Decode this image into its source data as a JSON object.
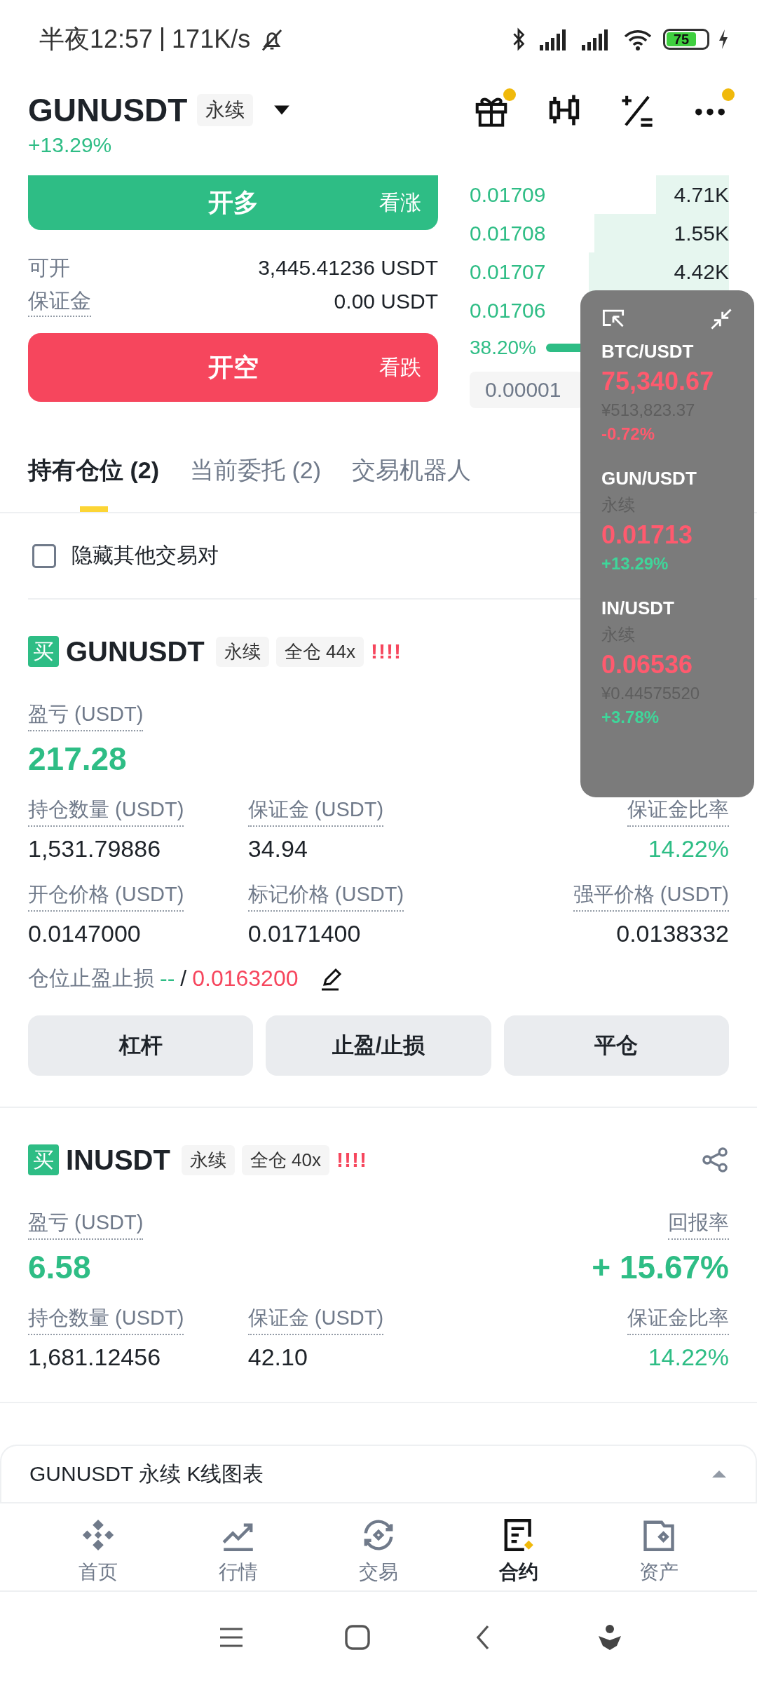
{
  "status_bar": {
    "time": "半夜12:57",
    "speed": "171K/s",
    "battery": "75"
  },
  "header": {
    "symbol": "GUNUSDT",
    "tag": "永续",
    "change": "+13.29%",
    "gift_badge": true,
    "more_badge": true
  },
  "order_buttons": [
    {
      "kind": "long",
      "label": "开多",
      "hint": "看涨"
    },
    {
      "kind": "short",
      "label": "开空",
      "hint": "看跌"
    }
  ],
  "account": [
    {
      "label": "可开",
      "value": "3,445.41236 USDT",
      "underlined": false
    },
    {
      "label": "保证金",
      "value": "0.00 USDT",
      "underlined": true
    }
  ],
  "order_book": {
    "rows": [
      {
        "price": "0.01709",
        "amount": "4.71K"
      },
      {
        "price": "0.01708",
        "amount": "1.55K"
      },
      {
        "price": "0.01707",
        "amount": "4.42K"
      },
      {
        "price": "0.01706"
      }
    ],
    "buy_ratio": "38.20%",
    "tick_size": "0.00001"
  },
  "tabs": [
    {
      "label": "持有仓位 (2)",
      "selected": true
    },
    {
      "label": "当前委托 (2)",
      "selected": false
    },
    {
      "label": "交易机器人",
      "selected": false
    }
  ],
  "hide_other_pairs": {
    "label": "隐藏其他交易对",
    "checked": false
  },
  "positions": [
    {
      "side": "买",
      "symbol": "GUNUSDT",
      "tags": [
        "永续",
        "全仓 44x"
      ],
      "risk": "!!!!",
      "pnl_label": "盈亏 (USDT)",
      "pnl": "217.28",
      "field_rows": [
        [
          {
            "label": "持仓数量 (USDT)",
            "value": "1,531.79886",
            "positive": false
          },
          {
            "label": "保证金 (USDT)",
            "value": "34.94",
            "positive": false
          },
          {
            "label": "保证金比率",
            "value": "14.22%",
            "positive": true
          }
        ],
        [
          {
            "label": "开仓价格 (USDT)",
            "value": "0.0147000",
            "positive": false
          },
          {
            "label": "标记价格 (USDT)",
            "value": "0.0171400",
            "positive": false
          },
          {
            "label": "强平价格 (USDT)",
            "value": "0.0138332",
            "positive": false
          }
        ]
      ],
      "tpsl": {
        "label": "仓位止盈止损",
        "tp": "--",
        "sep": "/",
        "sl": "0.0163200"
      },
      "actions": [
        "杠杆",
        "止盈/止损",
        "平仓"
      ]
    },
    {
      "side": "买",
      "symbol": "INUSDT",
      "tags": [
        "永续",
        "全仓 40x"
      ],
      "risk": "!!!!",
      "share": true,
      "pnl_label": "盈亏 (USDT)",
      "pnl": "6.58",
      "roi_label": "回报率",
      "roi": "+ 15.67%",
      "field_rows": [
        [
          {
            "label": "持仓数量 (USDT)",
            "value": "1,681.12456",
            "positive": false
          },
          {
            "label": "保证金 (USDT)",
            "value": "42.10",
            "positive": false
          },
          {
            "label": "保证金比率",
            "value": "14.22%",
            "positive": true
          }
        ]
      ]
    }
  ],
  "kline_bar": {
    "label": "GUNUSDT 永续 K线图表"
  },
  "bottom_nav": [
    {
      "kind": "home",
      "label": "首页",
      "selected": false
    },
    {
      "kind": "market",
      "label": "行情",
      "selected": false
    },
    {
      "kind": "trade",
      "label": "交易",
      "selected": false
    },
    {
      "kind": "futures",
      "label": "合约",
      "selected": true
    },
    {
      "kind": "assets",
      "label": "资产",
      "selected": false
    }
  ],
  "floating_ticker": [
    {
      "pair": "BTC/USDT",
      "price": "75,340.67",
      "price_rising": false,
      "fiat": "¥513,823.37",
      "change": "-0.72%",
      "change_rising": false
    },
    {
      "pair": "GUN/USDT",
      "tag": "永续",
      "price": "0.01713",
      "price_rising": false,
      "change": "+13.29%",
      "change_rising": true
    },
    {
      "pair": "IN/USDT",
      "tag": "永续",
      "price": "0.06536",
      "price_rising": false,
      "fiat": "¥0.44575520",
      "change": "+3.78%",
      "change_rising": true
    }
  ]
}
